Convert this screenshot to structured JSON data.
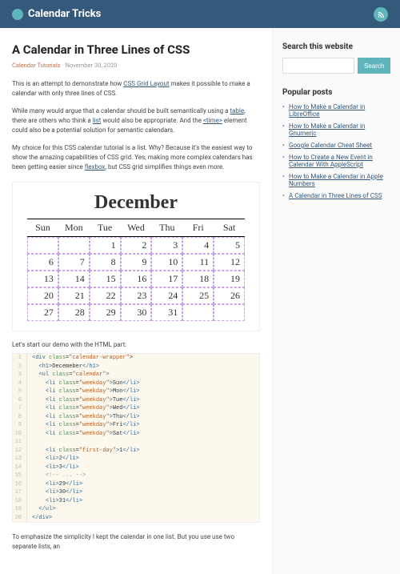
{
  "site": {
    "name": "Calendar Tricks"
  },
  "article": {
    "title": "A Calendar in Three Lines of CSS",
    "category": "Calendar Tutorials",
    "date": "November 30, 2020",
    "p1a": "This is an attempt to demonstrate how ",
    "p1link": "CSS Grid Layout",
    "p1b": " makes it possible to make a calendar with only three lines of CSS.",
    "p2a": "While many would argue that a calendar should be built semantically using a ",
    "p2l1": "table",
    "p2b": ", there are others who think a ",
    "p2l2": "list",
    "p2c": " would also be appropriate. And the ",
    "p2l3": "<time>",
    "p2d": " element could also be a potential solution for semantic calendars.",
    "p3a": "My choice for this CSS calendar tutorial is a list. Why? Because it's the easiest way to show the amazing capabilities of CSS grid. Yes, making more complex calendars has been getting easier since ",
    "p3l": "flexbox",
    "p3b": ", but CSS grid simplifies things even more.",
    "demoLabel": "Let's start our demo with the HTML part:",
    "closing": "To emphasize the simplicity I kept the calendar in one list. But you use use two separate lists, an"
  },
  "calendar": {
    "month": "December",
    "weekdays": [
      "Sun",
      "Mon",
      "Tue",
      "Wed",
      "Thu",
      "Fri",
      "Sat"
    ],
    "rows": [
      [
        "",
        "",
        "1",
        "2",
        "3",
        "4",
        "5"
      ],
      [
        "6",
        "7",
        "8",
        "9",
        "10",
        "11",
        "12"
      ],
      [
        "13",
        "14",
        "15",
        "16",
        "17",
        "18",
        "19"
      ],
      [
        "20",
        "21",
        "22",
        "23",
        "24",
        "25",
        "26"
      ],
      [
        "27",
        "28",
        "29",
        "30",
        "31",
        "",
        ""
      ]
    ]
  },
  "code": [
    {
      "n": "1",
      "h": "<span class='tag'>&lt;div</span> <span class='attr'>class</span>=<span class='str'>\"calendar-wrapper\"</span><span class='tagc'>&gt;</span>"
    },
    {
      "n": "2",
      "h": "  <span class='tag'>&lt;h1&gt;</span>Decemeber<span class='tag'>&lt;/h1&gt;</span>"
    },
    {
      "n": "3",
      "h": "  <span class='tag'>&lt;ul</span> <span class='attr'>class</span>=<span class='str'>\"calendar\"</span><span class='tag'>&gt;</span>"
    },
    {
      "n": "4",
      "h": "    <span class='tag'>&lt;li</span> <span class='attr'>class</span>=<span class='str'>\"weekday\"</span><span class='tag'>&gt;</span>Sun<span class='tag'>&lt;/li&gt;</span>"
    },
    {
      "n": "5",
      "h": "    <span class='tag'>&lt;li</span> <span class='attr'>class</span>=<span class='str'>\"weekday\"</span><span class='tag'>&gt;</span>Mon<span class='tag'>&lt;/li&gt;</span>"
    },
    {
      "n": "6",
      "h": "    <span class='tag'>&lt;li</span> <span class='attr'>class</span>=<span class='str'>\"weekday\"</span><span class='tag'>&gt;</span>Tue<span class='tag'>&lt;/li&gt;</span>"
    },
    {
      "n": "7",
      "h": "    <span class='tag'>&lt;li</span> <span class='attr'>class</span>=<span class='str'>\"weekday\"</span><span class='tag'>&gt;</span>Wed<span class='tag'>&lt;/li&gt;</span>"
    },
    {
      "n": "8",
      "h": "    <span class='tag'>&lt;li</span> <span class='attr'>class</span>=<span class='str'>\"weekday\"</span><span class='tag'>&gt;</span>Thu<span class='tag'>&lt;/li&gt;</span>"
    },
    {
      "n": "9",
      "h": "    <span class='tag'>&lt;li</span> <span class='attr'>class</span>=<span class='str'>\"weekday\"</span><span class='tag'>&gt;</span>Fri<span class='tag'>&lt;/li&gt;</span>"
    },
    {
      "n": "10",
      "h": "    <span class='tag'>&lt;li</span> <span class='attr'>class</span>=<span class='str'>\"weekday\"</span><span class='tag'>&gt;</span>Sat<span class='tag'>&lt;/li&gt;</span>"
    },
    {
      "n": "11",
      "h": ""
    },
    {
      "n": "12",
      "h": "    <span class='tag'>&lt;li</span> <span class='attr'>class</span>=<span class='str'>\"first-day\"</span><span class='tag'>&gt;</span>1<span class='tag'>&lt;/li&gt;</span>"
    },
    {
      "n": "13",
      "h": "    <span class='tag'>&lt;li&gt;</span>2<span class='tag'>&lt;/li&gt;</span>"
    },
    {
      "n": "14",
      "h": "    <span class='tag'>&lt;li&gt;</span>3<span class='tag'>&lt;/li&gt;</span>"
    },
    {
      "n": "15",
      "h": "    <span class='cmt'>&lt;!-- ... --&gt;</span>"
    },
    {
      "n": "16",
      "h": "    <span class='tag'>&lt;li&gt;</span>29<span class='tag'>&lt;/li&gt;</span>"
    },
    {
      "n": "17",
      "h": "    <span class='tag'>&lt;li&gt;</span>30<span class='tag'>&lt;/li&gt;</span>"
    },
    {
      "n": "18",
      "h": "    <span class='tag'>&lt;li&gt;</span>31<span class='tag'>&lt;/li&gt;</span>"
    },
    {
      "n": "19",
      "h": "  <span class='tag'>&lt;/ul&gt;</span>"
    },
    {
      "n": "20",
      "h": "<span class='tag'>&lt;/div&gt;</span>"
    }
  ],
  "sidebar": {
    "searchTitle": "Search this website",
    "searchBtn": "Search",
    "popTitle": "Popular posts",
    "popular": [
      "How to Make a Calendar in LibreOffice",
      "How to Make a Calendar in Gnumeric",
      "Google Calendar Cheat Sheet",
      "How to Create a New Event in Calendar With AppleScript",
      "How to Make a Calendar in Apple Numbers",
      "A Calendar in Three Lines of CSS"
    ]
  }
}
